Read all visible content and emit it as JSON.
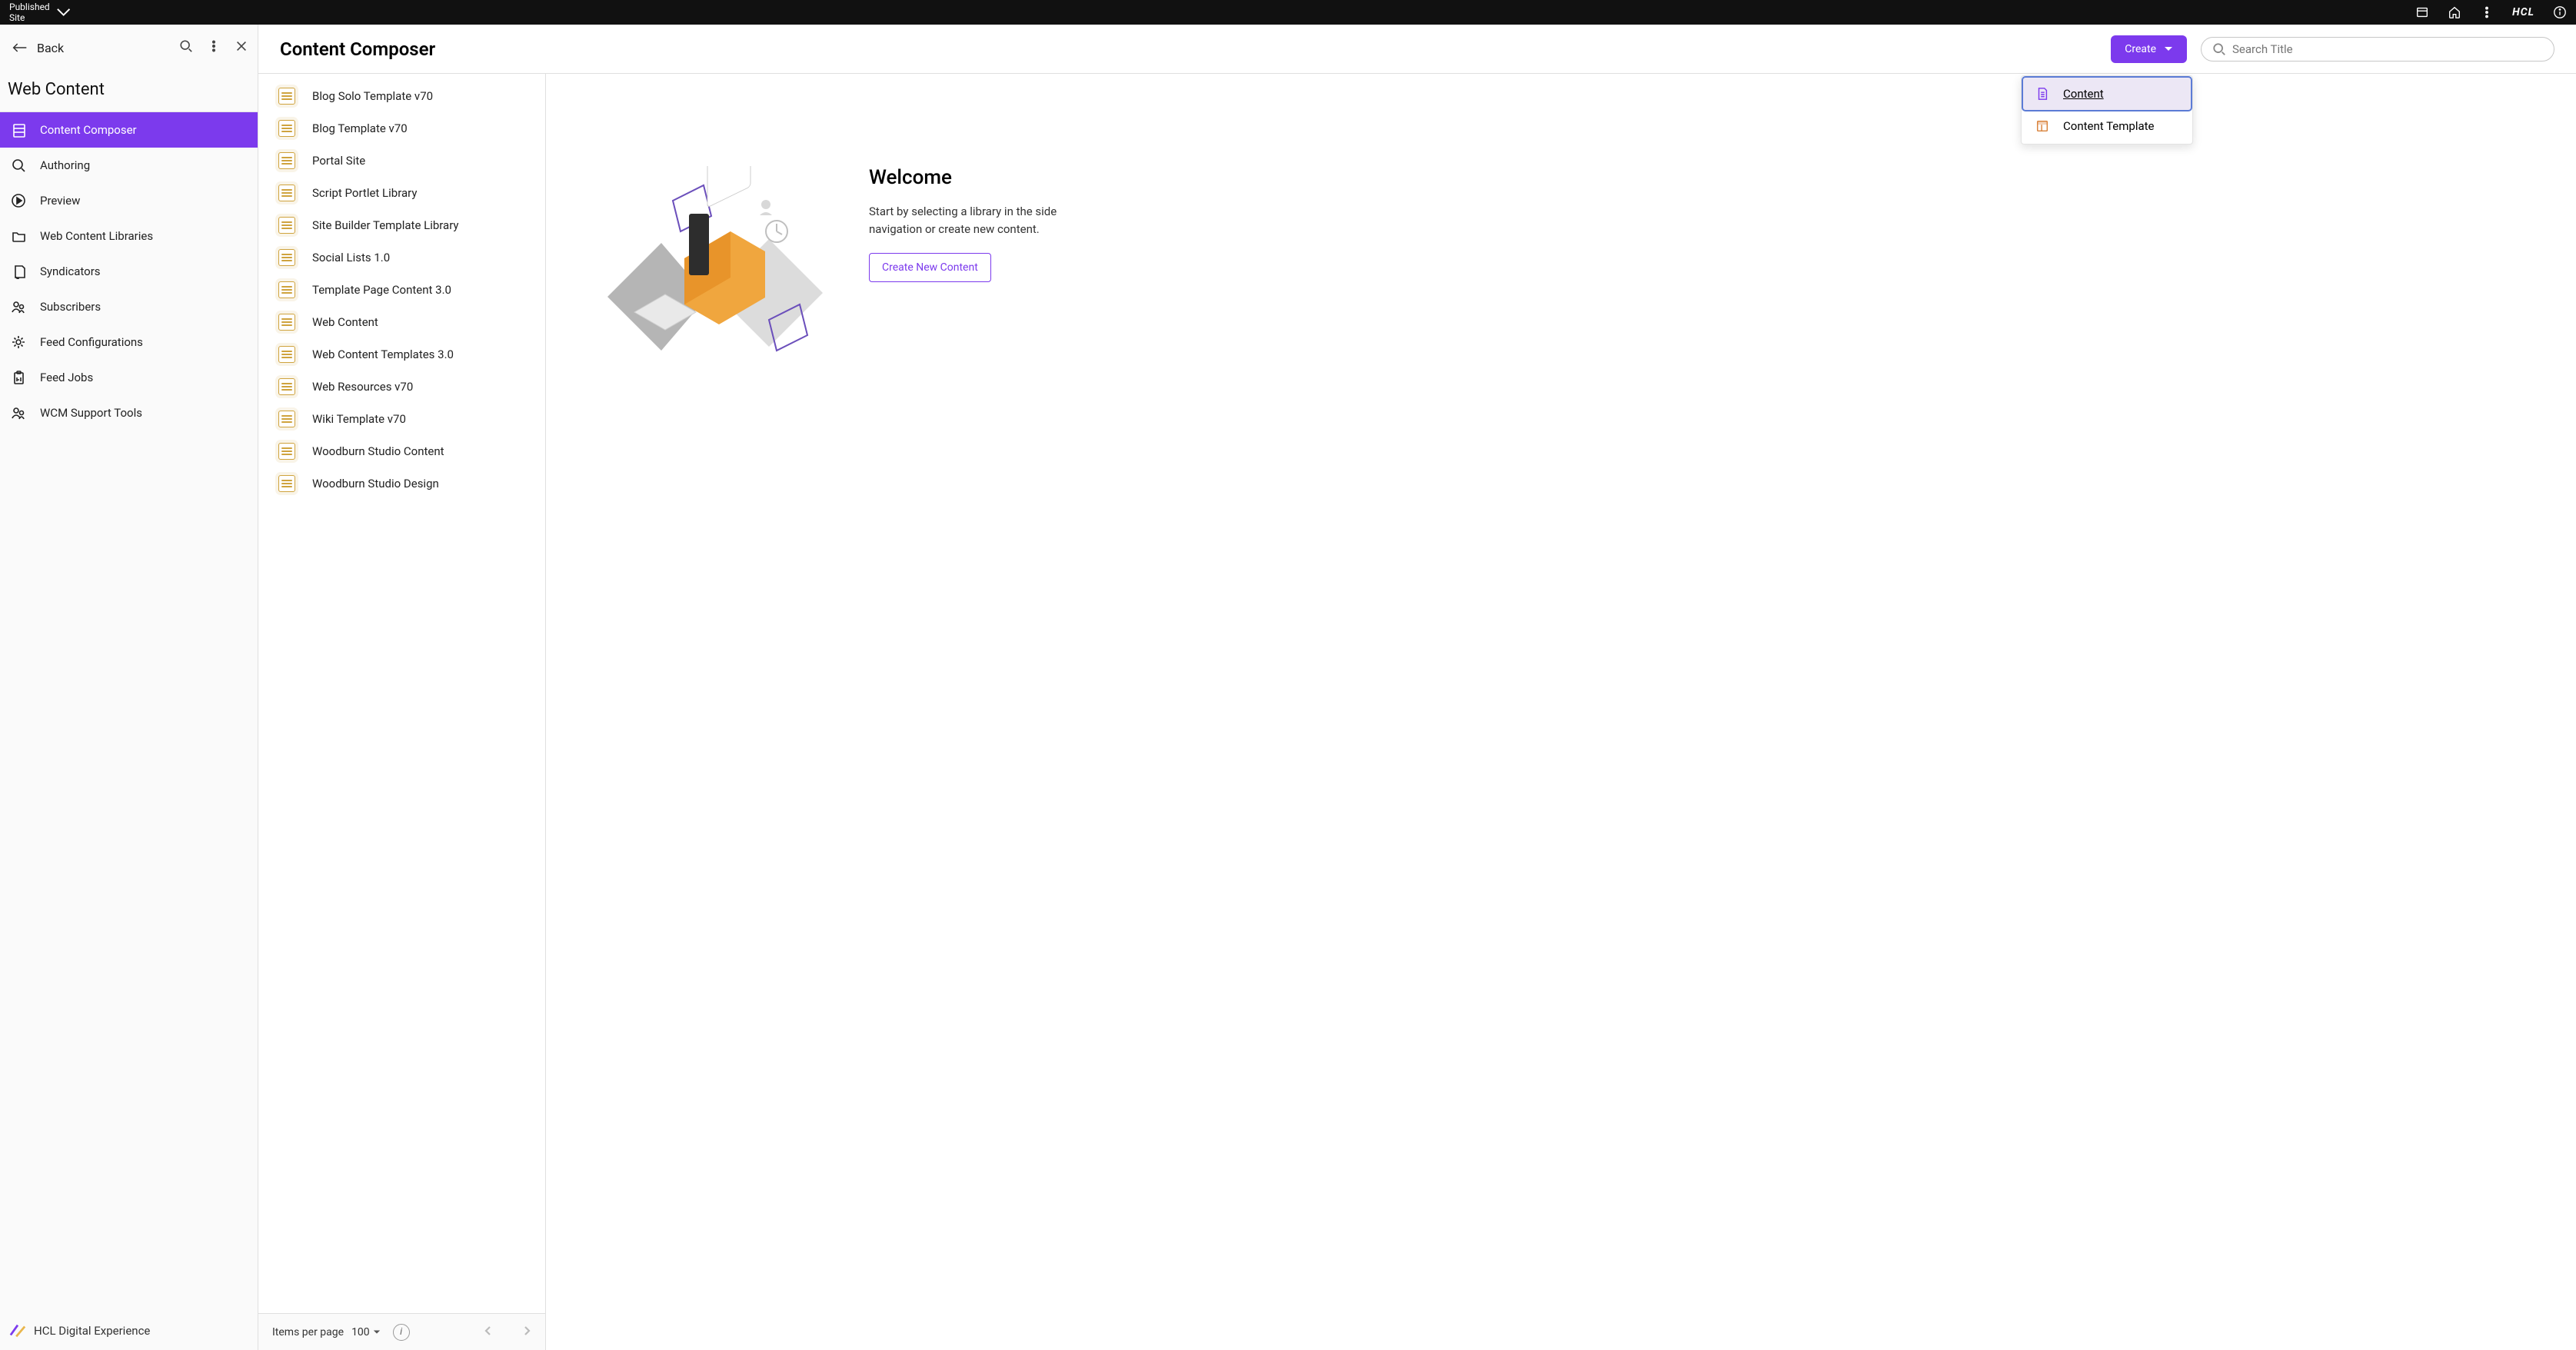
{
  "topbar": {
    "site_label": "Published Site",
    "brand": "HCL"
  },
  "sidebar": {
    "back_label": "Back",
    "title": "Web Content",
    "items": [
      {
        "label": "Content Composer",
        "icon": "library",
        "active": true
      },
      {
        "label": "Authoring",
        "icon": "search",
        "active": false
      },
      {
        "label": "Preview",
        "icon": "play",
        "active": false
      },
      {
        "label": "Web Content Libraries",
        "icon": "folder",
        "active": false
      },
      {
        "label": "Syndicators",
        "icon": "file-out",
        "active": false
      },
      {
        "label": "Subscribers",
        "icon": "people",
        "active": false
      },
      {
        "label": "Feed Configurations",
        "icon": "gear",
        "active": false
      },
      {
        "label": "Feed Jobs",
        "icon": "clipboard",
        "active": false
      },
      {
        "label": "WCM Support Tools",
        "icon": "people",
        "active": false
      }
    ],
    "footer": "HCL Digital Experience"
  },
  "header": {
    "title": "Content Composer",
    "create_label": "Create",
    "search_placeholder": "Search Title"
  },
  "create_menu": {
    "items": [
      {
        "label": "Content",
        "active": true,
        "color": "#7c3aed"
      },
      {
        "label": "Content Template",
        "active": false,
        "color": "#d9823b"
      }
    ]
  },
  "libraries": [
    {
      "label": "Blog Solo Template v70"
    },
    {
      "label": "Blog Template v70"
    },
    {
      "label": "Portal Site"
    },
    {
      "label": "Script Portlet Library"
    },
    {
      "label": "Site Builder Template Library"
    },
    {
      "label": "Social Lists 1.0"
    },
    {
      "label": "Template Page Content 3.0"
    },
    {
      "label": "Web Content"
    },
    {
      "label": "Web Content Templates 3.0"
    },
    {
      "label": "Web Resources v70"
    },
    {
      "label": "Wiki Template v70"
    },
    {
      "label": "Woodburn Studio Content"
    },
    {
      "label": "Woodburn Studio Design"
    }
  ],
  "pagination": {
    "label": "Items per page",
    "value": "100"
  },
  "welcome": {
    "heading": "Welcome",
    "body": "Start by selecting a library in the side navigation or create new content.",
    "button": "Create New Content"
  }
}
